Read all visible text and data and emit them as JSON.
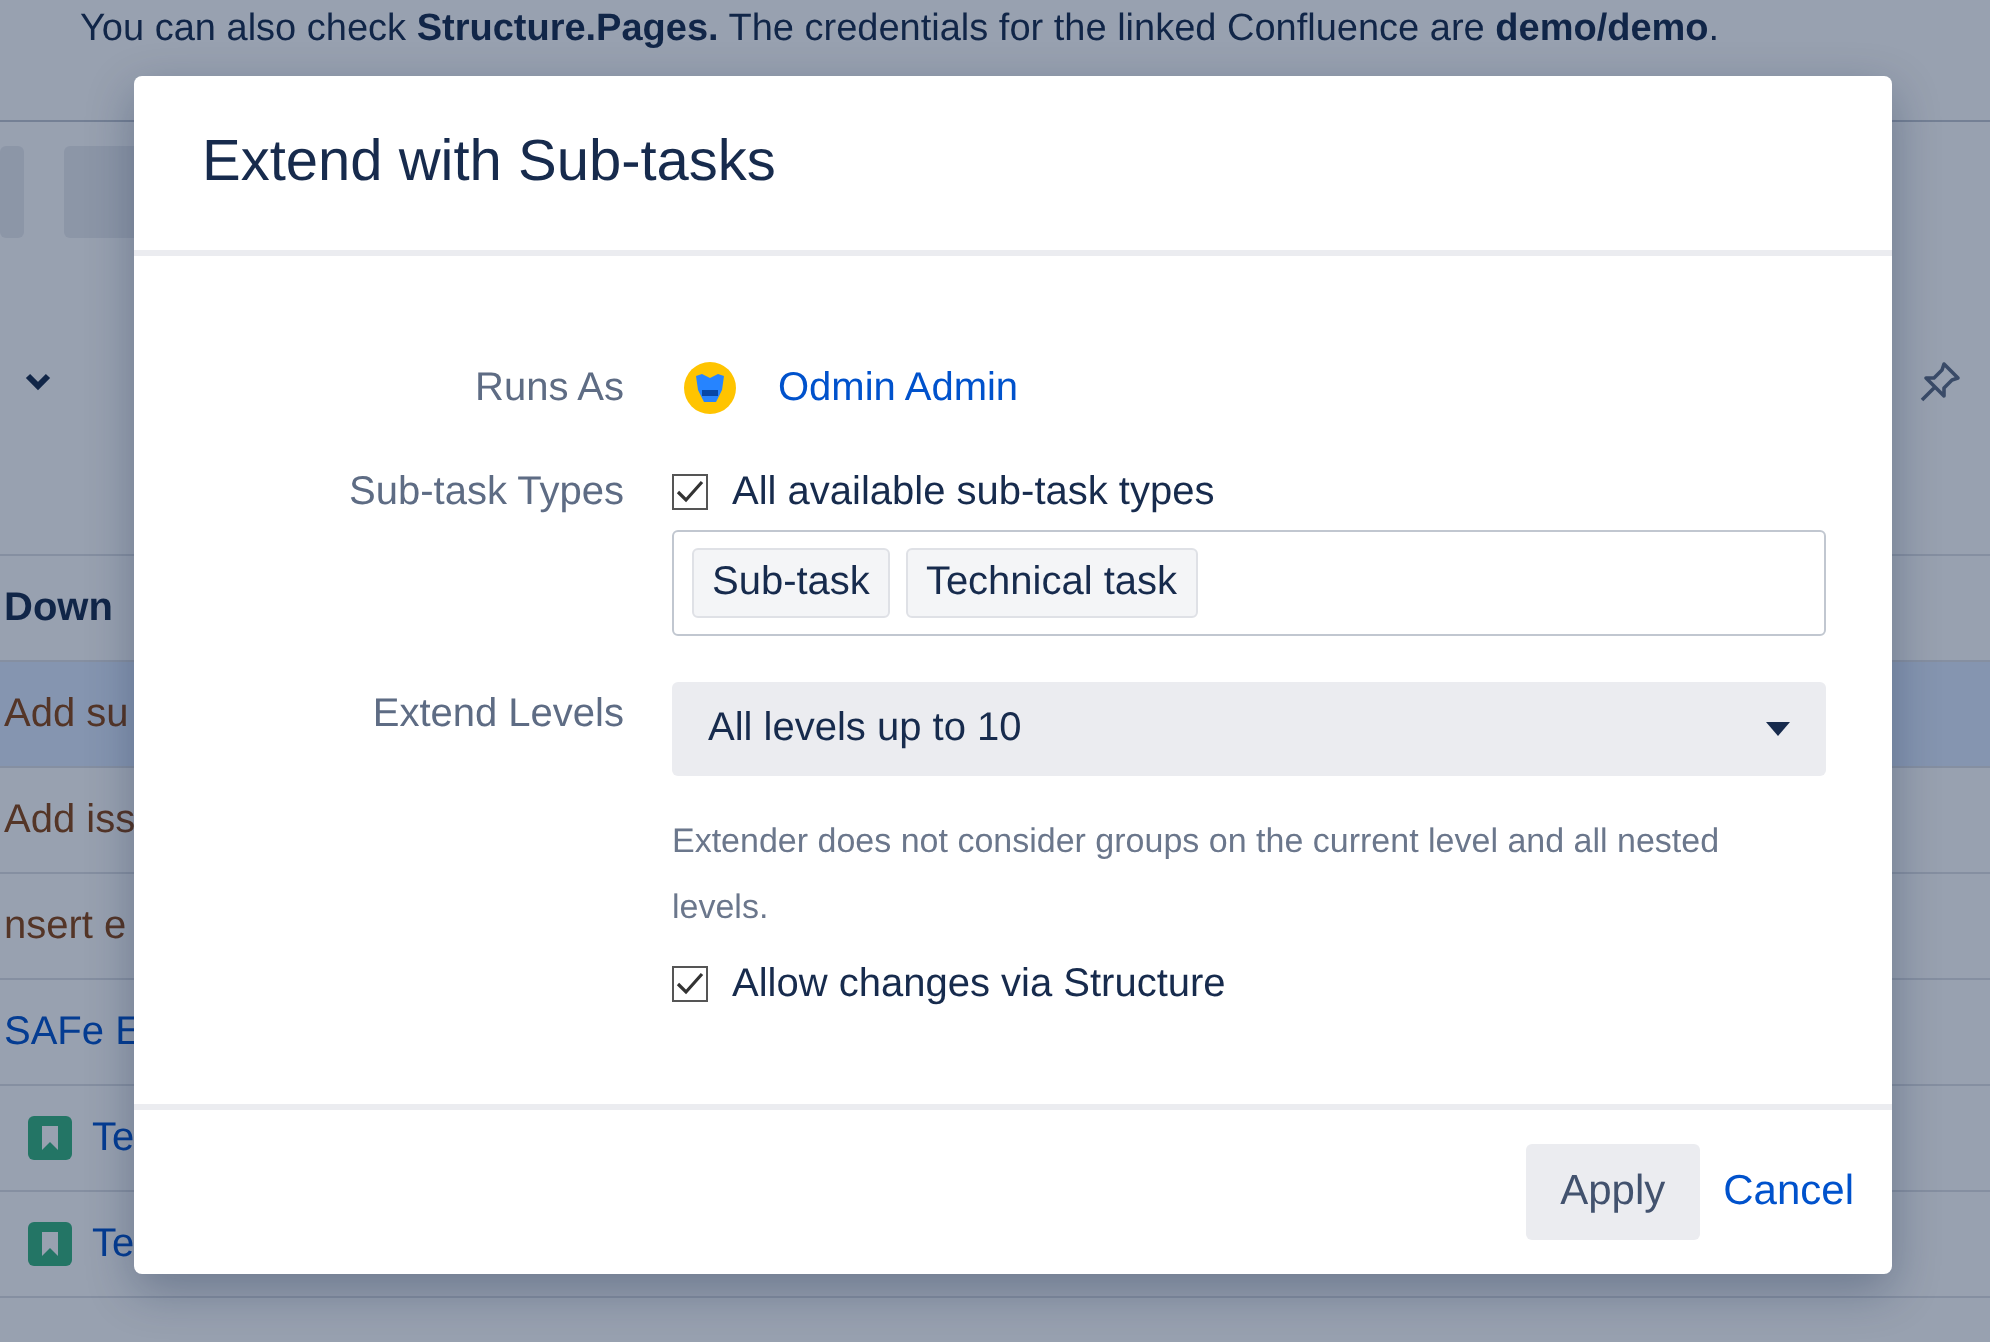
{
  "background": {
    "banner": "You can also check **Structure.Pages.** The credentials for the linked Confluence are **demo/demo**.",
    "column_header": "Down",
    "rows": [
      {
        "kind": "action",
        "text": "Add su",
        "selected": true
      },
      {
        "kind": "action",
        "text": "Add iss",
        "selected": false
      },
      {
        "kind": "action",
        "text": "nsert e",
        "selected": false
      },
      {
        "kind": "link",
        "text": "SAFe E",
        "selected": false
      },
      {
        "kind": "issue",
        "text": "Te",
        "selected": false
      },
      {
        "kind": "issue",
        "text": "Te",
        "selected": false
      }
    ]
  },
  "dialog": {
    "title": "Extend with Sub-tasks",
    "runs_as": {
      "label": "Runs As",
      "user": "Odmin Admin"
    },
    "subtask_types": {
      "label": "Sub-task Types",
      "all_types": {
        "label": "All available sub-task types",
        "checked": true
      },
      "tags": [
        "Sub-task",
        "Technical task"
      ]
    },
    "extend_levels": {
      "label": "Extend Levels",
      "value": "All levels up to 10",
      "help": "Extender does not consider groups on the current level and all nested levels."
    },
    "allow_changes": {
      "label": "Allow changes via Structure",
      "checked": true
    },
    "buttons": [
      {
        "kind": "primary",
        "label": "Apply"
      },
      {
        "kind": "link",
        "label": "Cancel"
      }
    ]
  }
}
